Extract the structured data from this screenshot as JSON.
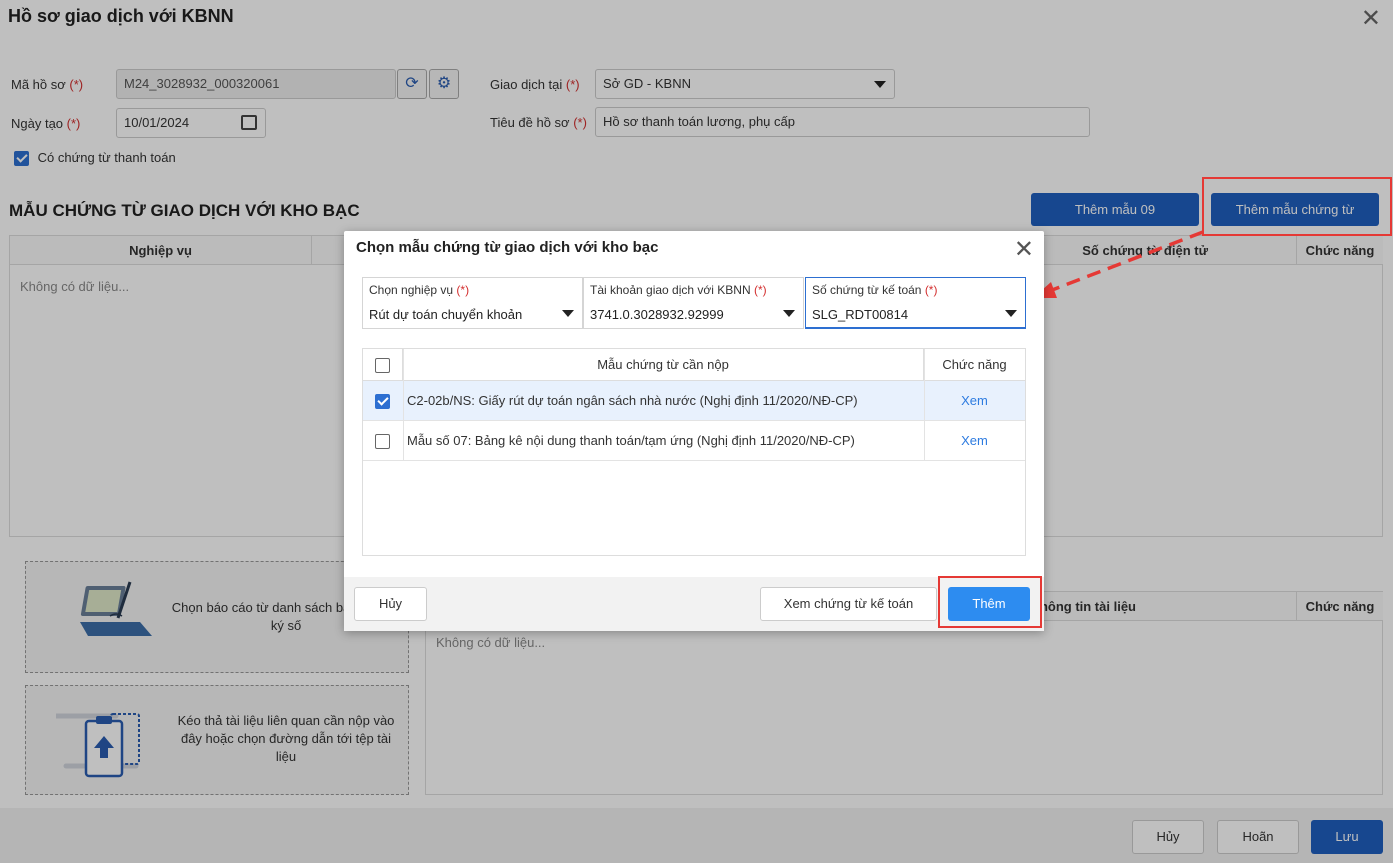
{
  "page": {
    "title": "Hồ sơ giao dịch với KBNN",
    "form": {
      "ma_ho_so_label": "Mã hồ sơ",
      "ma_ho_so_value": "M24_3028932_000320061",
      "ngay_tao_label": "Ngày tạo",
      "ngay_tao_value": "10/01/2024",
      "giao_dich_tai_label": "Giao dịch tại",
      "giao_dich_tai_value": "Sở GD - KBNN",
      "tieu_de_label": "Tiêu đề hồ sơ",
      "tieu_de_value": "Hồ sơ thanh toán lương, phụ cấp",
      "co_chung_tu_label": "Có chứng từ thanh toán",
      "required_mark": "(*)"
    },
    "section_title": "MẪU CHỨNG TỪ GIAO DỊCH VỚI KHO BẠC",
    "btn_them_mau_09": "Thêm mẫu 09",
    "btn_them_mau_chung_tu": "Thêm mẫu chứng từ",
    "grid1": {
      "col_nghiep_vu": "Nghiệp vụ",
      "col_so_chung_tu": "Số chứng từ điện tử",
      "col_chuc_nang": "Chức năng",
      "empty": "Không có dữ liệu..."
    },
    "drop1_text": "Chọn báo cáo từ danh sách báo cáo đã ký số",
    "drop2_text": "Kéo thả tài liệu liên quan cần nộp vào đây hoặc chọn đường dẫn tới tệp tài liệu",
    "grid2": {
      "col_thong_tin": "Thông tin tài liệu",
      "col_chuc_nang": "Chức năng",
      "empty": "Không có dữ liệu..."
    },
    "footer": {
      "huy": "Hủy",
      "hoan": "Hoãn",
      "luu": "Lưu"
    }
  },
  "modal": {
    "title": "Chọn mẫu chứng từ giao dịch với kho bạc",
    "fields": [
      {
        "label": "Chọn nghiệp vụ",
        "value": "Rút dự toán chuyển khoản"
      },
      {
        "label": "Tài khoản giao dịch với KBNN",
        "value": "3741.0.3028932.92999"
      },
      {
        "label": "Số chứng từ kế toán",
        "value": "SLG_RDT00814"
      }
    ],
    "required_mark": "(*)",
    "table": {
      "col_mau": "Mẫu chứng từ cần nộp",
      "col_chuc_nang": "Chức năng",
      "rows": [
        {
          "name": "C2-02b/NS: Giấy rút dự toán ngân sách nhà nước (Nghị định 11/2020/NĐ-CP)",
          "action": "Xem",
          "checked": true
        },
        {
          "name": "Mẫu số 07: Bảng kê nội dung thanh toán/tạm ứng (Nghị định 11/2020/NĐ-CP)",
          "action": "Xem",
          "checked": false
        }
      ]
    },
    "btn_huy": "Hủy",
    "btn_xem": "Xem chứng từ kế toán",
    "btn_them": "Thêm"
  },
  "colors": {
    "primary": "#1f5fbf",
    "accent_blue": "#2d8cf0",
    "highlight_red": "#e53935"
  },
  "icons": [
    "close-icon",
    "refresh-icon",
    "gear-icon",
    "calendar-icon",
    "chevron-down-icon",
    "laptop-sign-icon",
    "clipboard-upload-icon"
  ]
}
